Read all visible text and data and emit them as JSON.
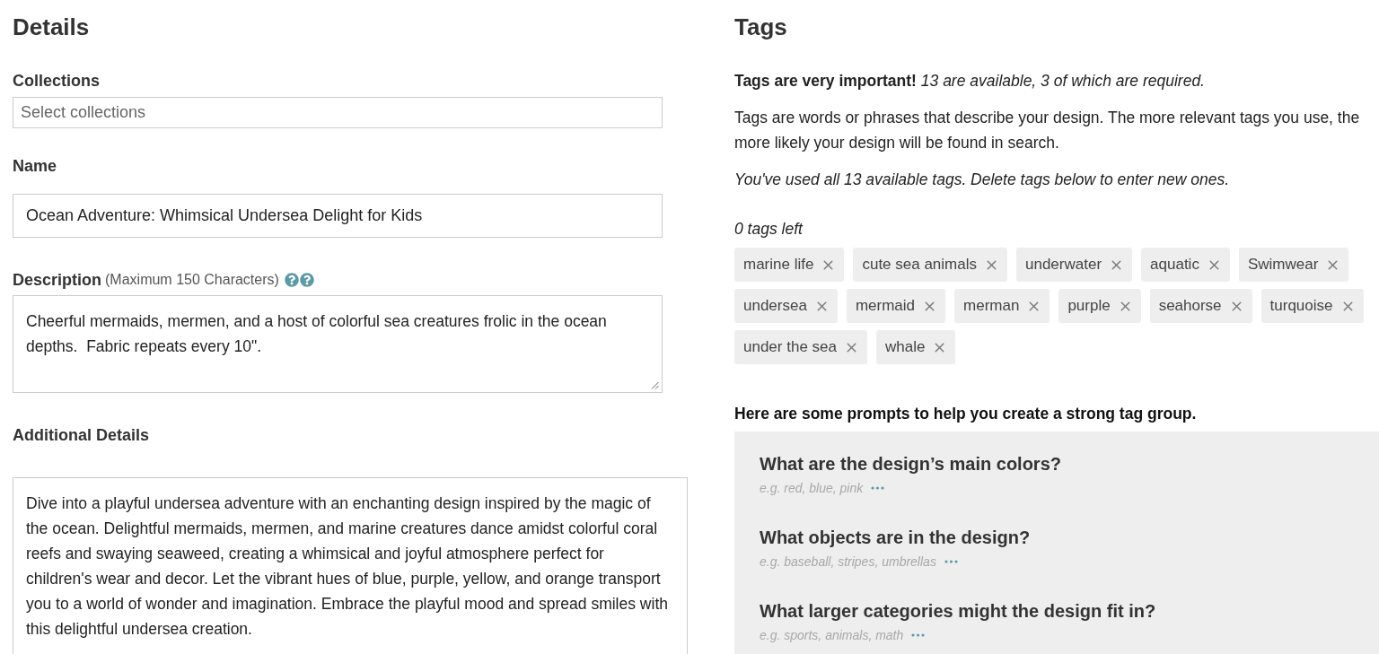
{
  "details": {
    "title": "Details",
    "collections": {
      "label": "Collections",
      "placeholder": "Select collections"
    },
    "name": {
      "label": "Name",
      "value": "Ocean Adventure: Whimsical Undersea Delight for Kids"
    },
    "description": {
      "label": "Description",
      "note": "(Maximum 150 Characters)",
      "value": "Cheerful mermaids, mermen, and a host of colorful sea creatures frolic in the ocean depths.  Fabric repeats every 10\"."
    },
    "additional_details": {
      "label": "Additional Details",
      "value": "Dive into a playful undersea adventure with an enchanting design inspired by the magic of the ocean. Delightful mermaids, mermen, and marine creatures dance amidst colorful coral reefs and swaying seaweed, creating a whimsical and joyful atmosphere perfect for children's wear and decor. Let the vibrant hues of blue, purple, yellow, and orange transport you to a world of wonder and imagination. Embrace the playful mood and spread smiles with this delightful undersea creation."
    }
  },
  "tags": {
    "title": "Tags",
    "importance": "**Tags are very important!** *13 are available, 3 of which are required.*",
    "intro": "Tags are words or phrases that describe your design. The more relevant tags you use, the more likely your design will be found in search.",
    "limit_notice": "You've used all 13 available tags. Delete tags below to enter new ones.",
    "remaining": "0 tags left",
    "items": [
      "marine life",
      "cute sea animals",
      "underwater",
      "aquatic",
      "Swimwear",
      "undersea",
      "mermaid",
      "merman",
      "purple",
      "seahorse",
      "turquoise",
      "under the sea",
      "whale"
    ],
    "prompts_heading": "Here are some prompts to help you create a strong tag group.",
    "prompts": [
      {
        "question": "What are the design’s main colors?",
        "hint": "e.g. red, blue, pink"
      },
      {
        "question": "What objects are in the design?",
        "hint": "e.g. baseball, stripes, umbrellas"
      },
      {
        "question": "What larger categories might the design fit in?",
        "hint": "e.g. sports, animals, math"
      }
    ]
  }
}
